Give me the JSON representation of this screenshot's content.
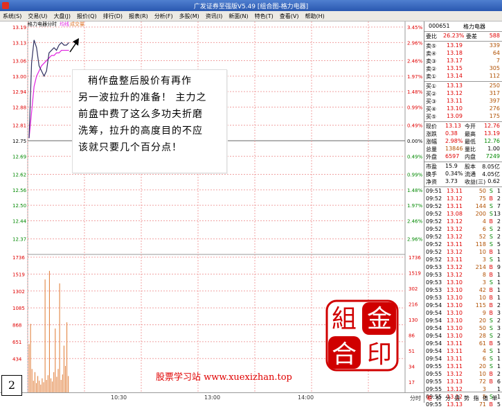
{
  "window": {
    "title": "广发证券至强版V5.49   [组合图-格力电器]"
  },
  "menu": [
    "系统(S)",
    "交易(U)",
    "大盘(J)",
    "报价(Q)",
    "排行(D)",
    "报表(R)",
    "分析(F)",
    "多股(M)",
    "资讯(I)",
    "新面(N)",
    "特色(T)",
    "查看(V)",
    "帮助(H)"
  ],
  "chart_header": {
    "stock": "格力电器",
    "mode": "分时",
    "avg_label": "均线",
    "vol_label": "成交量"
  },
  "chart_data": {
    "type": "line",
    "prev_close": 12.75,
    "price_ticks": [
      "13.19",
      "13.13",
      "13.06",
      "13.00",
      "12.94",
      "12.88",
      "12.81",
      "12.75",
      "12.69",
      "12.62",
      "12.56",
      "12.50",
      "12.44",
      "12.37"
    ],
    "pct_ticks": [
      "3.45%",
      "2.96%",
      "2.46%",
      "1.97%",
      "1.48%",
      "0.99%",
      "0.49%",
      "0.00%",
      "0.49%",
      "0.99%",
      "1.48%",
      "1.97%",
      "2.46%",
      "2.96%"
    ],
    "vol_ticks_left": [
      "1736",
      "1519",
      "1302",
      "1085",
      "868",
      "651",
      "434"
    ],
    "vol_ticks_right": [
      "1736",
      "1519",
      "302",
      "216",
      "130",
      "86",
      "51",
      "34",
      "17"
    ],
    "time_labels": [
      "10:30",
      "13:00",
      "14:00",
      "分时"
    ],
    "price_series": [
      12.76,
      13.05,
      13.14,
      13.11,
      13.04,
      13.02,
      13.0,
      13.02,
      13.09,
      13.1,
      13.11,
      13.1,
      13.12,
      13.13,
      13.12,
      13.12,
      13.13
    ],
    "avg_series": [
      12.76,
      12.86,
      12.96,
      13.0,
      13.02,
      13.04,
      13.05,
      13.06,
      13.07,
      13.08,
      13.08,
      13.09,
      13.09,
      13.1,
      13.1,
      13.1,
      13.1
    ],
    "volumes": [
      620,
      880,
      300,
      150,
      260,
      120,
      210,
      150,
      100,
      180,
      130,
      1450,
      160,
      220,
      1560,
      180,
      140,
      260,
      820,
      200,
      300,
      1400,
      160,
      230,
      600,
      340,
      900,
      210
    ]
  },
  "annotation": {
    "lines": [
      "稍作盘整后股价有再作",
      "另一波拉升的准备！ 主力之",
      "前盘中费了这么多功夫折磨",
      "洗筹，拉升的高度目的不应",
      "该就只要几个百分点！"
    ]
  },
  "quote": {
    "code": "000651",
    "name": "格力电器",
    "weibi_label": "委比",
    "weibi": "26.23%",
    "weicha_label": "委差",
    "weicha": "588",
    "asks": [
      {
        "label": "卖⑤",
        "price": "13.19",
        "vol": "339"
      },
      {
        "label": "卖④",
        "price": "13.18",
        "vol": "64"
      },
      {
        "label": "卖③",
        "price": "13.17",
        "vol": "7"
      },
      {
        "label": "卖②",
        "price": "13.15",
        "vol": "305"
      },
      {
        "label": "卖①",
        "price": "13.14",
        "vol": "112"
      }
    ],
    "bids": [
      {
        "label": "买①",
        "price": "13.13",
        "vol": "250"
      },
      {
        "label": "买②",
        "price": "13.12",
        "vol": "317"
      },
      {
        "label": "买③",
        "price": "13.11",
        "vol": "397"
      },
      {
        "label": "买④",
        "price": "13.10",
        "vol": "276"
      },
      {
        "label": "买⑤",
        "price": "13.09",
        "vol": "175"
      }
    ],
    "stats": [
      {
        "l1": "现价",
        "v1": "13.13",
        "l2": "今开",
        "v2": "12.76"
      },
      {
        "l1": "涨跌",
        "v1": "0.38",
        "l2": "最高",
        "v2": "13.19"
      },
      {
        "l1": "涨幅",
        "v1": "2.98%",
        "l2": "最低",
        "v2": "12.76"
      },
      {
        "l1": "总量",
        "v1": "13846",
        "l2": "量比",
        "v2": "1.00"
      },
      {
        "l1": "外盘",
        "v1": "6597",
        "l2": "内盘",
        "v2": "7249"
      }
    ],
    "fund": [
      {
        "l1": "市盈",
        "v1": "15.9",
        "l2": "股本",
        "v2": "8.05亿"
      },
      {
        "l1": "换手",
        "v1": "0.34%",
        "l2": "流通",
        "v2": "4.05亿"
      },
      {
        "l1": "净资",
        "v1": "3.73",
        "l2": "收益(三)",
        "v2": "0.62"
      }
    ]
  },
  "ticks": [
    {
      "t": "09:51",
      "p": "13.11",
      "v": "50",
      "d": "S",
      "n": "1"
    },
    {
      "t": "09:52",
      "p": "13.12",
      "v": "75",
      "d": "B",
      "n": "2"
    },
    {
      "t": "09:52",
      "p": "13.11",
      "v": "144",
      "d": "S",
      "n": "7"
    },
    {
      "t": "09:52",
      "p": "13.08",
      "v": "200",
      "d": "S",
      "n": "13"
    },
    {
      "t": "09:52",
      "p": "13.12",
      "v": "4",
      "d": "B",
      "n": "2"
    },
    {
      "t": "09:52",
      "p": "13.12",
      "v": "6",
      "d": "S",
      "n": "2"
    },
    {
      "t": "09:52",
      "p": "13.12",
      "v": "52",
      "d": "S",
      "n": "2"
    },
    {
      "t": "09:52",
      "p": "13.11",
      "v": "118",
      "d": "S",
      "n": "5"
    },
    {
      "t": "09:52",
      "p": "13.12",
      "v": "10",
      "d": "B",
      "n": "1"
    },
    {
      "t": "09:52",
      "p": "13.11",
      "v": "3",
      "d": "S",
      "n": "1"
    },
    {
      "t": "09:53",
      "p": "13.12",
      "v": "214",
      "d": "B",
      "n": "9"
    },
    {
      "t": "09:53",
      "p": "13.12",
      "v": "8",
      "d": "B",
      "n": "1"
    },
    {
      "t": "09:53",
      "p": "13.10",
      "v": "3",
      "d": "S",
      "n": "1"
    },
    {
      "t": "09:53",
      "p": "13.10",
      "v": "42",
      "d": "B",
      "n": "1"
    },
    {
      "t": "09:53",
      "p": "13.10",
      "v": "10",
      "d": "B",
      "n": "1"
    },
    {
      "t": "09:54",
      "p": "13.10",
      "v": "115",
      "d": "B",
      "n": "2"
    },
    {
      "t": "09:54",
      "p": "13.10",
      "v": "9",
      "d": "B",
      "n": "3"
    },
    {
      "t": "09:54",
      "p": "13.10",
      "v": "20",
      "d": "S",
      "n": "2"
    },
    {
      "t": "09:54",
      "p": "13.10",
      "v": "50",
      "d": "S",
      "n": "3"
    },
    {
      "t": "09:54",
      "p": "13.10",
      "v": "28",
      "d": "S",
      "n": "2"
    },
    {
      "t": "09:54",
      "p": "13.11",
      "v": "61",
      "d": "B",
      "n": "5"
    },
    {
      "t": "09:54",
      "p": "13.11",
      "v": "4",
      "d": "S",
      "n": "1"
    },
    {
      "t": "09:54",
      "p": "13.11",
      "v": "6",
      "d": "S",
      "n": "1"
    },
    {
      "t": "09:55",
      "p": "13.11",
      "v": "20",
      "d": "S",
      "n": "1"
    },
    {
      "t": "09:55",
      "p": "13.12",
      "v": "10",
      "d": "B",
      "n": "2"
    },
    {
      "t": "09:55",
      "p": "13.13",
      "v": "72",
      "d": "B",
      "n": "6"
    },
    {
      "t": "09:55",
      "p": "13.12",
      "v": "3",
      "d": "",
      "n": "1"
    },
    {
      "t": "09:55",
      "p": "13.12",
      "v": "5",
      "d": "S",
      "n": "1"
    },
    {
      "t": "09:55",
      "p": "13.13",
      "v": "71",
      "d": "B",
      "n": "5"
    }
  ],
  "bottom_tabs": [
    "笔",
    "价",
    "分",
    "盘",
    "势",
    "指",
    "值",
    "单"
  ],
  "seal": {
    "chars": [
      "组",
      "金",
      "合",
      "印"
    ]
  },
  "watermark": "股票学习站   www.xuexizhan.top",
  "badge": "2",
  "colors": {
    "up": "#e00000",
    "down": "#008800",
    "price_line": "#303060",
    "avg_line": "#e020e0",
    "volume_bar": "#e07830",
    "grid_dash": "#f08080"
  }
}
